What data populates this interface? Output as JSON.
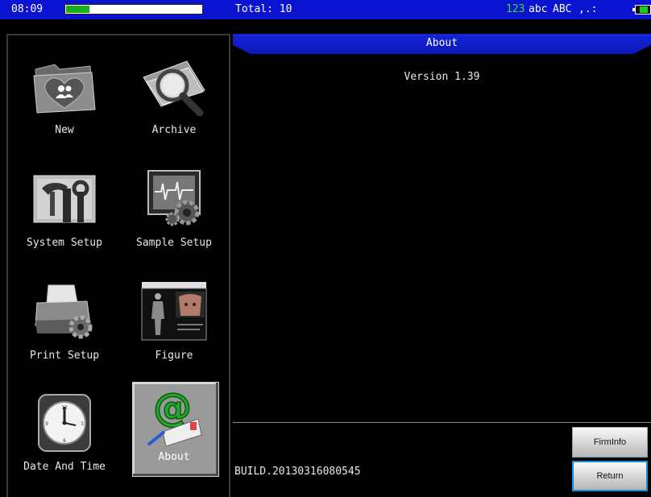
{
  "status_bar": {
    "time": "08:09",
    "progress": 0.17,
    "total": "Total: 10",
    "input_modes": [
      "123",
      "abc",
      "ABC",
      ",.:"
    ],
    "active_input_mode_color": "#33e033",
    "battery_icon": "battery-icon"
  },
  "menu": {
    "items": [
      {
        "label": "New",
        "icon": "new-folder-heart-icon"
      },
      {
        "label": "Archive",
        "icon": "archive-magnifier-icon"
      },
      {
        "label": "System Setup",
        "icon": "system-setup-tools-icon"
      },
      {
        "label": "Sample Setup",
        "icon": "sample-setup-gear-icon"
      },
      {
        "label": "Print Setup",
        "icon": "print-setup-printer-icon"
      },
      {
        "label": "Figure",
        "icon": "figure-body-icon"
      },
      {
        "label": "Date And Time",
        "icon": "clock-icon"
      },
      {
        "label": "About",
        "icon": "about-at-icon",
        "selected": true
      }
    ]
  },
  "panel": {
    "title": "About",
    "version": "Version 1.39",
    "build": "BUILD.20130316080545",
    "buttons": {
      "firminfo": "FirmInfo",
      "return": "Return"
    }
  },
  "colors": {
    "header_blue": "#0a14d0",
    "selection_gray": "#9a9a9a",
    "accent_green": "#33e033"
  }
}
